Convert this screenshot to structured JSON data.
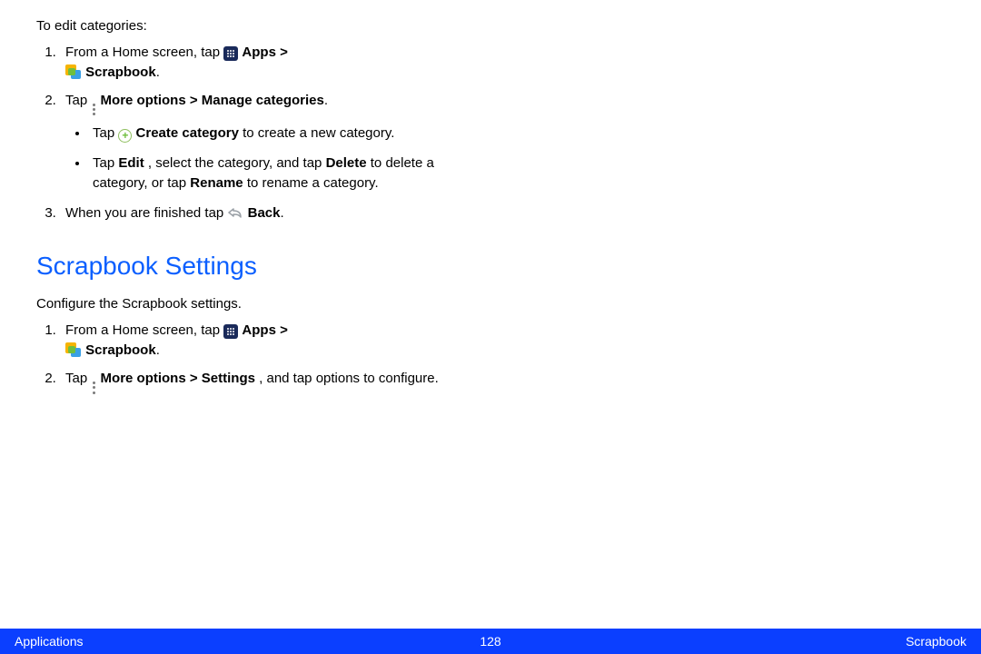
{
  "edit": {
    "intro": "To edit categories:",
    "step1_prefix": "From a Home screen, tap ",
    "apps_label": " Apps > ",
    "scrapbook_label": " Scrapbook",
    "period": ".",
    "step2_tap": "Tap ",
    "step2_path": " More options > Manage categories",
    "bullet1_tap": "Tap ",
    "bullet1_bold": " Create category",
    "bullet1_rest": " to create a new category.",
    "bullet2_tap": "Tap ",
    "bullet2_edit": "Edit",
    "bullet2_mid": ", select the category, and tap ",
    "bullet2_delete": "Delete",
    "bullet2_mid2": " to delete a category, or tap ",
    "bullet2_rename": "Rename",
    "bullet2_rest": " to rename a category.",
    "step3_prefix": "When you are finished tap ",
    "back_label": " Back"
  },
  "settings": {
    "heading": "Scrapbook Settings",
    "intro": "Configure the Scrapbook settings.",
    "step1_prefix": "From a Home screen, tap ",
    "apps_label": " Apps > ",
    "scrapbook_label": " Scrapbook",
    "period": ".",
    "step2_tap": "Tap ",
    "step2_bold": " More options > Settings",
    "step2_rest": ", and tap options to configure."
  },
  "footer": {
    "left": "Applications",
    "page": "128",
    "right": "Scrapbook"
  }
}
